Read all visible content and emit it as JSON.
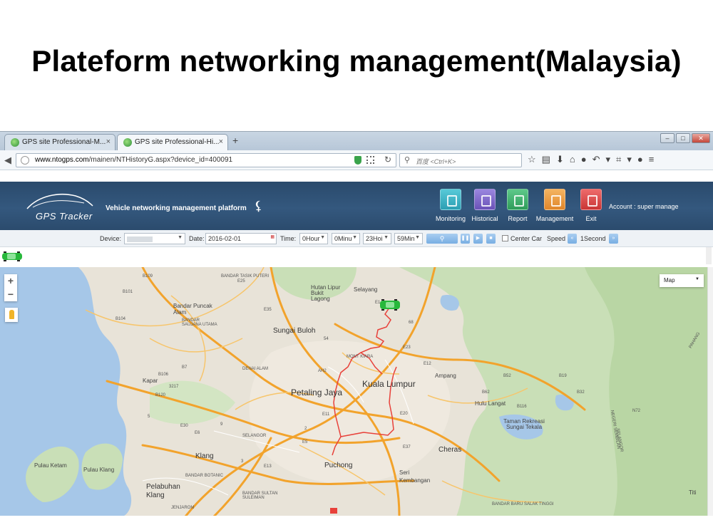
{
  "slide": {
    "title": "Plateform networking management(Malaysia)"
  },
  "browser": {
    "tabs": [
      {
        "label": "GPS site Professional-M...",
        "close": "×"
      },
      {
        "label": "GPS site Professional-Hi...",
        "close": "×"
      }
    ],
    "new_tab": "+",
    "url": {
      "domain": "www.ntogps.com",
      "path": "/mainen/NTHistoryG.aspx?device_id=400091"
    },
    "search_placeholder": "百度 <Ctrl+K>",
    "window_controls": [
      "–",
      "□",
      "✕"
    ],
    "toolbar_icons": [
      "star-icon",
      "reading-list-icon",
      "download-icon",
      "home-icon",
      "chat-icon",
      "undo-icon",
      "screenshot-icon",
      "menu-icon"
    ]
  },
  "app": {
    "logo_text": "GPS Tracker",
    "platform_name": "Vehicle networking management platform",
    "nav": {
      "monitoring": "Monitoring",
      "historical": "Historical",
      "report": "Report",
      "management": "Management",
      "exit": "Exit"
    },
    "account": "Account : super manage",
    "colors": {
      "header": "#34587e",
      "monitoring": "#2c9fb3",
      "historical": "#6a52b8",
      "report": "#2f9c5a",
      "management": "#e0862a",
      "exit": "#c93535"
    }
  },
  "controls": {
    "device_label": "Device:",
    "date_label": "Date:",
    "date_value": "2016-02-01",
    "time_label": "Time:",
    "hour_from": "0Hour",
    "min_from": "0Minu",
    "hour_to": "23Hoi",
    "min_to": "59Min",
    "center_car_label": "Center Car",
    "speed_label": "Speed",
    "speed_value": "1Second"
  },
  "map": {
    "map_type": "Map",
    "zoom_in": "+",
    "zoom_out": "−",
    "labels": {
      "kuala_lumpur": "Kuala Lumpur",
      "petaling_jaya": "Petaling Jaya",
      "sungai_buloh": "Sungai Buloh",
      "klang": "Klang",
      "puchong": "Puchong",
      "cheras": "Cheras",
      "ampang": "Ampang",
      "seri_kembangan": "Seri Kembangan",
      "pelabuhan_klang": "Pelabuhan Klang",
      "bandar_puncak_alam": "Bandar Puncak Alam",
      "kapar": "Kapar",
      "selayang": "Selayang",
      "hutan_lipur": "Hutan Lipur Bukit Lagong",
      "hulu_langat": "Hulu Langat",
      "taman_rekreasi": "Taman Rekreasi Sungai Tekala",
      "pulau_ketam": "Pulau Ketam",
      "pulau_klang": "Pulau Klang",
      "mont_kiara": "MONT KIARA",
      "selangor": "SELANGOR",
      "bandar_saujana": "BANDAR SAUJANA UTAMA",
      "denai_alam": "DENAI ALAM",
      "bandar_sultan": "BANDAR SULTAN SULEIMAN",
      "titi": "Titi",
      "pahang": "PAHANG",
      "n_sembilan": "NEGERI SEMBILAN",
      "selangor_e": "SELANGOR",
      "bandar_baru": "BANDAR BARU SALAK TINGGI",
      "bandar_rawang": "BANDAR TASIK PUTERI",
      "jenjarom": "JENJAROM",
      "kemuning": "BANDAR BOTANIC"
    },
    "road_codes": [
      "B109",
      "E25",
      "B101",
      "B104",
      "B106",
      "B7",
      "E35",
      "E1",
      "54",
      "E23",
      "E12",
      "68",
      "AH2",
      "E30",
      "E20",
      "B52",
      "B19",
      "B32",
      "N72",
      "B116",
      "B62",
      "9",
      "5",
      "2",
      "3",
      "E11",
      "E13",
      "E6",
      "E5",
      "E37",
      "3217",
      "B120"
    ]
  }
}
